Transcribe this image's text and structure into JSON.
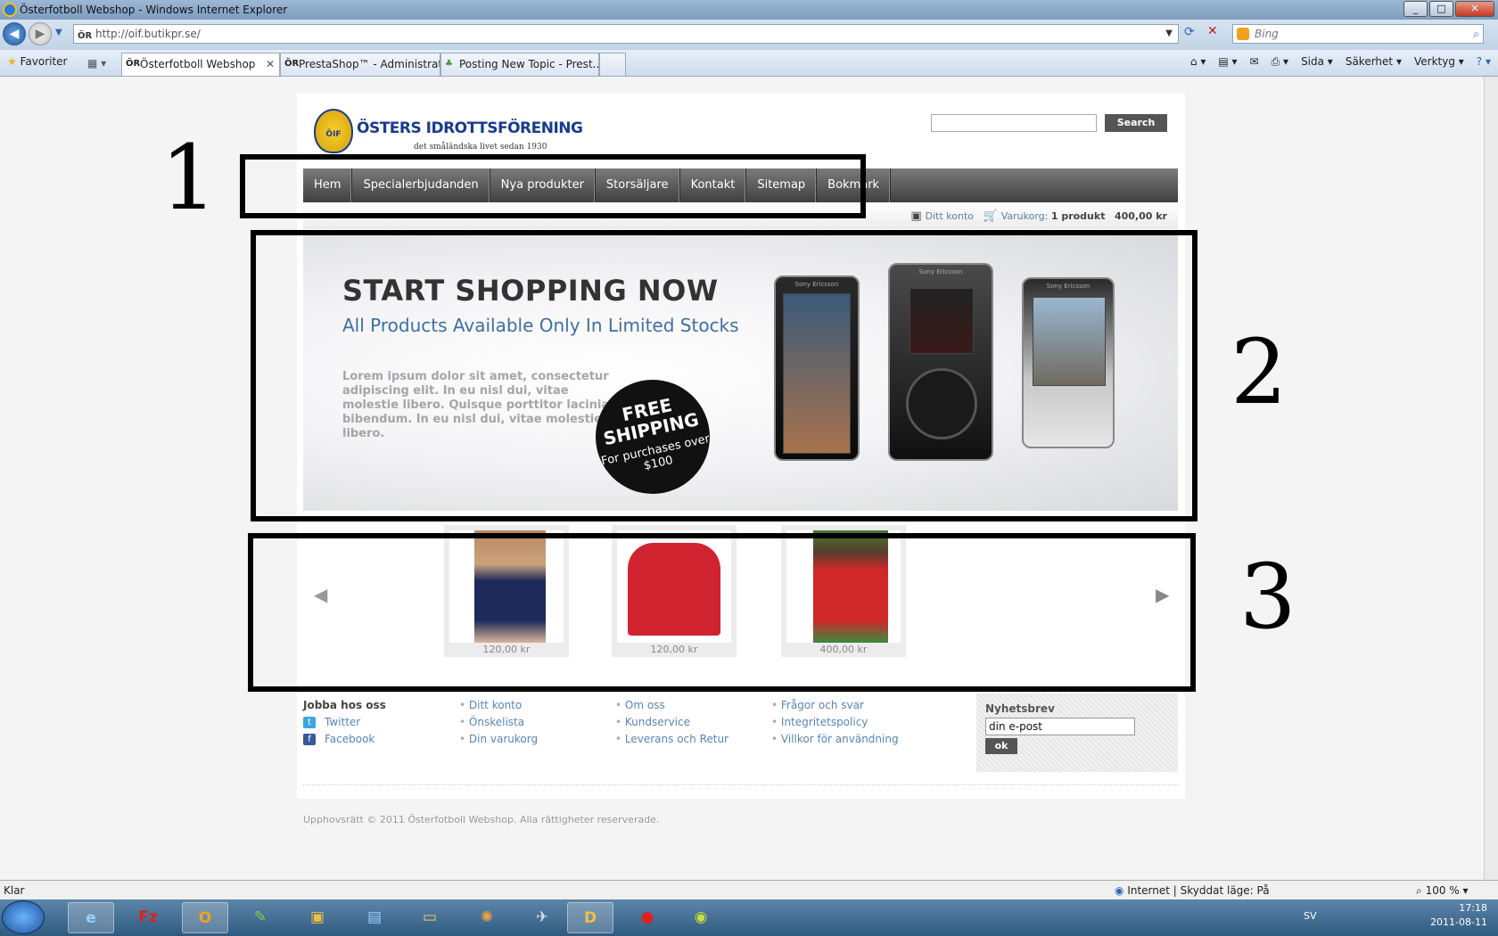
{
  "window": {
    "title": "Österfotboll Webshop - Windows Internet Explorer"
  },
  "addressbar": {
    "url": "http://oif.butikpr.se/",
    "search_placeholder": "Bing"
  },
  "favorites": {
    "label": "Favoriter"
  },
  "tabs": [
    {
      "label": "Österfotboll Webshop"
    },
    {
      "label": "PrestaShop™ - Administrat..."
    },
    {
      "label": "Posting New Topic - Prest..."
    }
  ],
  "commandbar": {
    "page": "Sida",
    "safety": "Säkerhet",
    "tools": "Verktyg"
  },
  "site": {
    "logo_name": "ÖSTERS IDROTTSFÖRENING",
    "logo_badge": "ÖIF",
    "logo_tagline": "det småländska livet sedan 1930",
    "search_button": "Search",
    "menu": [
      "Hem",
      "Specialerbjudanden",
      "Nya produkter",
      "Storsäljare",
      "Kontakt",
      "Sitemap",
      "Bokmärk"
    ],
    "account_link": "Ditt konto",
    "cart_label": "Varukorg:",
    "cart_count": "1 produkt",
    "cart_total": "400,00 kr"
  },
  "banner": {
    "heading": "START SHOPPING NOW",
    "subheading": "All Products Available Only In Limited Stocks",
    "body": "Lorem ipsum dolor sit amet, consectetur adipiscing elit. In eu nisl dui, vitae molestie libero. Quisque porttitor lacinia bibendum. In eu nisl dui, vitae molestie libero.",
    "badge_big": "FREE SHIPPING",
    "badge_small": "For purchases over $100",
    "phone_brand": "Sony Ericsson"
  },
  "products": [
    {
      "price": "120,00 kr"
    },
    {
      "price": "120,00 kr"
    },
    {
      "price": "400,00 kr"
    }
  ],
  "footer": {
    "col1_heading": "Jobba hos oss",
    "twitter": "Twitter",
    "facebook": "Facebook",
    "col2": [
      "Ditt konto",
      "Önskelista",
      "Din varukorg"
    ],
    "col3": [
      "Om oss",
      "Kundservice",
      "Leverans och Retur"
    ],
    "col4": [
      "Frågor och svar",
      "Integritetspolicy",
      "Villkor för användning"
    ],
    "newsletter_heading": "Nyhetsbrev",
    "newsletter_value": "din e-post",
    "newsletter_button": "ok",
    "copyright": "Upphovsrätt © 2011 Österfotboll Webshop. Alla rättigheter reserverade."
  },
  "annotations": [
    "1",
    "2",
    "3"
  ],
  "statusbar": {
    "text": "Klar",
    "zone": "Internet | Skyddat läge: På",
    "zoom": "100 %"
  },
  "taskbar": {
    "lang": "SV",
    "time": "17:18",
    "date": "2011-08-11"
  }
}
